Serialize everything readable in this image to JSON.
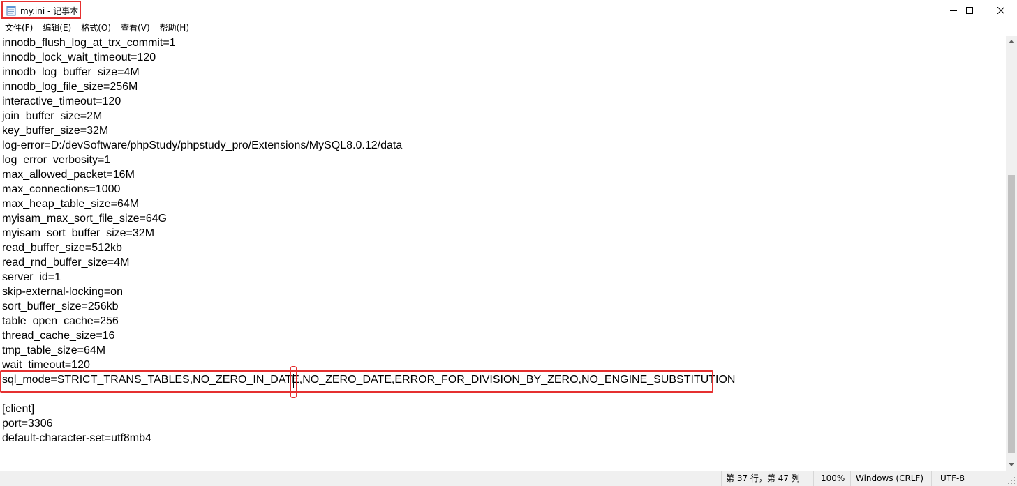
{
  "window": {
    "title": "my.ini - 记事本",
    "controls": {
      "minimize": "minimize-icon",
      "maximize": "maximize-icon",
      "close": "close-icon"
    }
  },
  "menu": [
    {
      "label": "文件(F)"
    },
    {
      "label": "编辑(E)"
    },
    {
      "label": "格式(O)"
    },
    {
      "label": "查看(V)"
    },
    {
      "label": "帮助(H)"
    }
  ],
  "editor": {
    "lines": [
      "innodb_flush_log_at_trx_commit=1",
      "innodb_lock_wait_timeout=120",
      "innodb_log_buffer_size=4M",
      "innodb_log_file_size=256M",
      "interactive_timeout=120",
      "join_buffer_size=2M",
      "key_buffer_size=32M",
      "log-error=D:/devSoftware/phpStudy/phpstudy_pro/Extensions/MySQL8.0.12/data",
      "log_error_verbosity=1",
      "max_allowed_packet=16M",
      "max_connections=1000",
      "max_heap_table_size=64M",
      "myisam_max_sort_file_size=64G",
      "myisam_sort_buffer_size=32M",
      "read_buffer_size=512kb",
      "read_rnd_buffer_size=4M",
      "server_id=1",
      "skip-external-locking=on",
      "sort_buffer_size=256kb",
      "table_open_cache=256",
      "thread_cache_size=16",
      "tmp_table_size=64M",
      "wait_timeout=120",
      "sql_mode=STRICT_TRANS_TABLES,NO_ZERO_IN_DATE,NO_ZERO_DATE,ERROR_FOR_DIVISION_BY_ZERO,NO_ENGINE_SUBSTITUTION",
      "",
      "[client]",
      "port=3306",
      "default-character-set=utf8mb4"
    ]
  },
  "status": {
    "position": "第 37 行，第 47 列",
    "zoom": "100%",
    "line_ending": "Windows (CRLF)",
    "encoding": "UTF-8"
  },
  "colors": {
    "annotation": "#e53030"
  }
}
